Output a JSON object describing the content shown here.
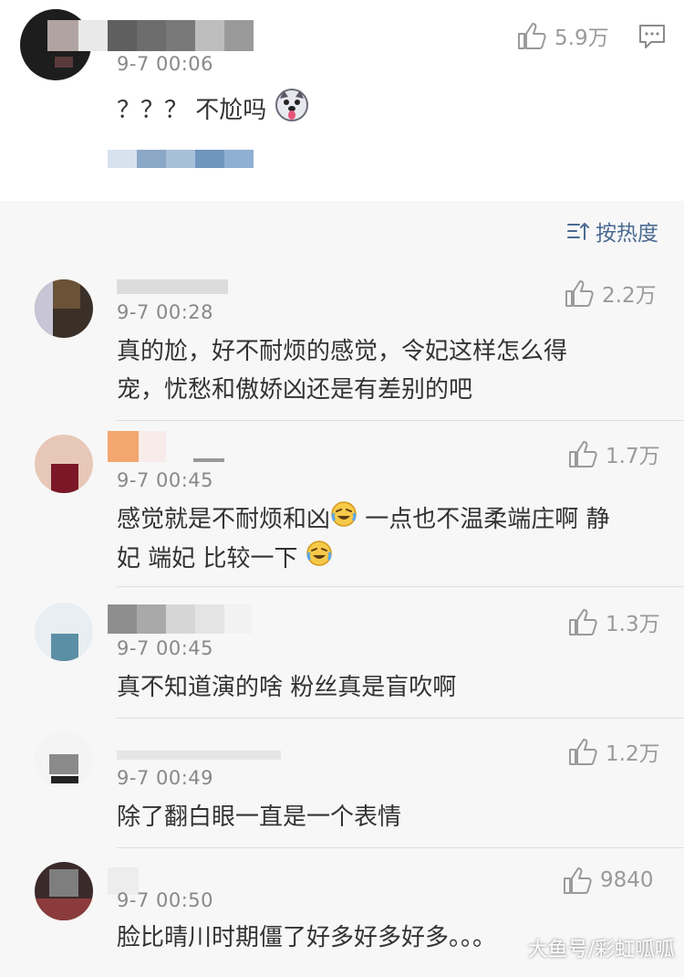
{
  "top_comment": {
    "time": "9-7 00:06",
    "text": "？？？ 不尬吗",
    "likes": "5.9万",
    "emoji": "husky-emoji"
  },
  "sort": {
    "label": "按热度",
    "icon": "sort-icon"
  },
  "comments": [
    {
      "time": "9-7 00:28",
      "likes": "2.2万",
      "line1": "真的尬，好不耐烦的感觉，令妃这样怎么得",
      "line2": "宠，忧愁和傲娇凶还是有差别的吧"
    },
    {
      "time": "9-7 00:45",
      "likes": "1.7万",
      "line1": "感觉就是不耐烦和凶",
      "line1b": "一点也不温柔端庄啊 静",
      "line2": "妃 端妃 比较一下"
    },
    {
      "time": "9-7 00:45",
      "likes": "1.3万",
      "line1": "真不知道演的啥 粉丝真是盲吹啊"
    },
    {
      "time": "9-7 00:49",
      "likes": "1.2万",
      "line1": "除了翻白眼一直是一个表情"
    },
    {
      "time": "9-7 00:50",
      "likes": "9840",
      "line1": "脸比晴川时期僵了好多好多好多。。。"
    }
  ],
  "watermark": "大鱼号/彩虹呱呱",
  "colors": {
    "accent": "#4b6b92",
    "muted": "#9a9a9a",
    "text": "#333333"
  }
}
